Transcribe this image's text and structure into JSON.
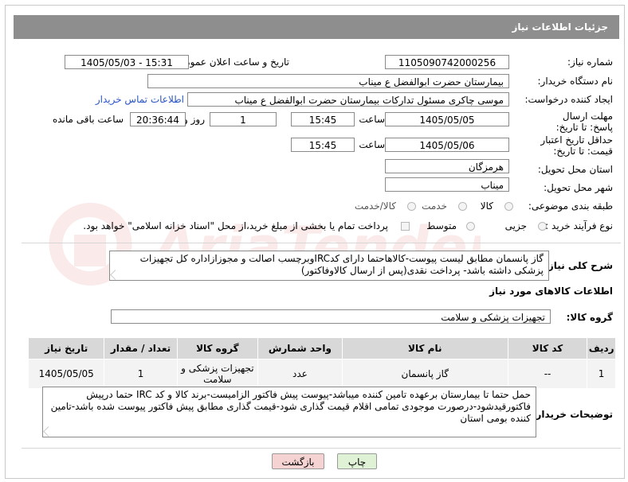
{
  "header": {
    "title": "جزئیات اطلاعات نیاز"
  },
  "fields": {
    "need_number_label": "شماره نیاز:",
    "need_number": "1105090742000256",
    "announce_label": "تاریخ و ساعت اعلان عمومی:",
    "announce_value": "1405/05/03 - 15:31",
    "buyer_org_label": "نام دستگاه خریدار:",
    "buyer_org": "بیمارستان حضرت ابوالفضل ع  میناب",
    "requester_label": "ایجاد کننده درخواست:",
    "requester": "موسی چاکری مسئول تدارکات بیمارستان حضرت ابوالفضل ع  میناب",
    "contact_link": "اطلاعات تماس خریدار",
    "deadline_label": "مهلت ارسال پاسخ: تا تاریخ:",
    "deadline_date": "1405/05/05",
    "time_label": "ساعت",
    "deadline_time": "15:45",
    "days_value": "1",
    "days_label": "روز و",
    "remaining_time": "20:36:44",
    "remaining_label": "ساعت باقی مانده",
    "price_valid_label": "حداقل تاریخ اعتبار قیمت: تا تاریخ:",
    "price_valid_date": "1405/05/06",
    "price_valid_time": "15:45",
    "province_label": "استان محل تحویل:",
    "province": "هرمزگان",
    "city_label": "شهر محل تحویل:",
    "city": "میناب",
    "category_label": "طبقه بندی موضوعی:",
    "category_options": [
      "کالا",
      "خدمت",
      "کالا/خدمت"
    ],
    "process_label": "نوع فرآیند خرید :",
    "process_options": [
      "جزیی",
      "متوسط"
    ],
    "payment_note": "پرداخت تمام یا بخشی از مبلغ خرید،از محل \"اسناد خزانه اسلامی\" خواهد بود."
  },
  "description": {
    "label": "شرح کلی نیاز:",
    "text": "گاز پانسمان مطابق لیست پیوست-کالاهاحتما دارای کدIRCوبرچسب اصالت و مجوزازاداره کل تجهیزات پزشکی داشته باشد- پرداخت نقدی(پس از ارسال کالاوفاکتور)"
  },
  "goods_section": {
    "title": "اطلاعات کالاهای مورد نیاز",
    "group_label": "گروه کالا:",
    "group_value": "تجهیزات پزشکی و سلامت"
  },
  "table": {
    "headers": [
      "ردیف",
      "کد کالا",
      "نام کالا",
      "واحد شمارش",
      "گروه کالا",
      "تعداد / مقدار",
      "تاریخ نیاز"
    ],
    "rows": [
      [
        "1",
        "--",
        "گاز پانسمان",
        "عدد",
        "تجهیزات پزشکی و سلامت",
        "1",
        "1405/05/05"
      ]
    ]
  },
  "buyer_notes": {
    "label": "توضیحات خریدار:",
    "text": "حمل حتما تا بیمارستان برعهده تامین کننده میباشد-پیوست پیش فاکتور الزامیست-برند کالا و کد IRC حتما درپیش فاکتورقیدشود-درصورت موجودی تمامی اقلام قیمت گذاری شود-قیمت گذاری مطابق پیش فاکتور پیوست شده باشد-تامین کننده بومی استان"
  },
  "buttons": {
    "print": "چاپ",
    "back": "بازگشت"
  },
  "watermark": {
    "text": "AriaTender.neT"
  },
  "colors": {
    "header_bg": "#8e8e8e",
    "link": "#2a55c4",
    "back_btn": "#f6d3d3",
    "print_btn": "#dff2d6"
  }
}
